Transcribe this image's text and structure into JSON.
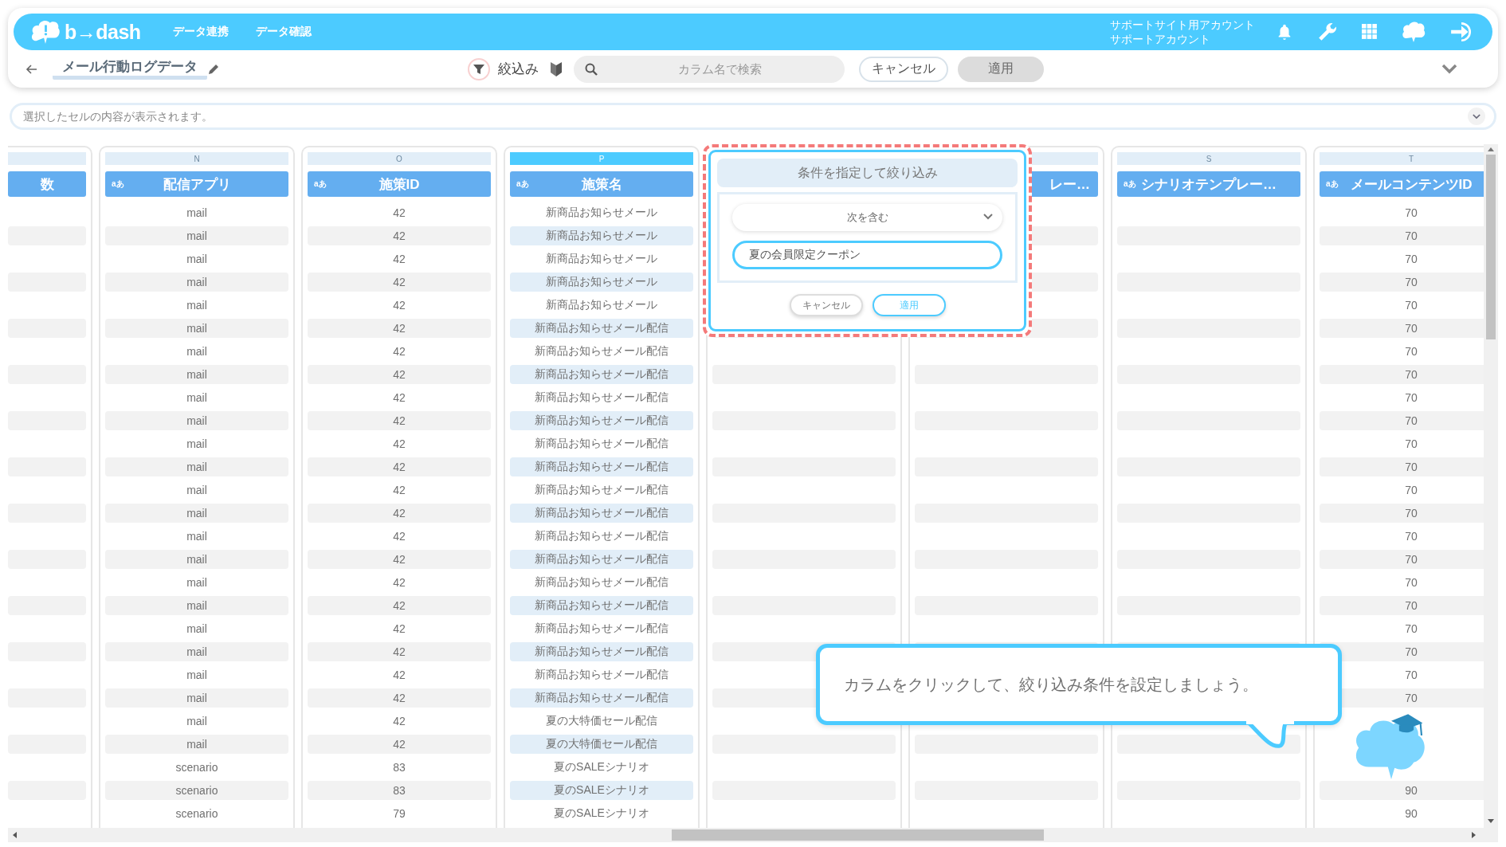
{
  "top_bar": {
    "logo": "b→dash",
    "nav": [
      "データ連携",
      "データ確認"
    ],
    "account": [
      "サポートサイト用アカウント",
      "サポートアカウント"
    ]
  },
  "toolbar": {
    "title": "メール行動ログデータ",
    "filter_label": "絞込み",
    "search": {
      "placeholder": "カラム名で検索"
    },
    "buttons": [
      {
        "label": "キャンセル",
        "disabled": false
      },
      {
        "label": "適用",
        "disabled": true
      }
    ]
  },
  "cell_bar": {
    "placeholder": "選択したセルの内容が表示されます。"
  },
  "table": {
    "columns": [
      {
        "header": "数",
        "selected": false
      },
      {
        "letter": "N",
        "badge": "aあ",
        "header": "配信アプリ",
        "selected": false,
        "cells": [
          "mail",
          "mail",
          "mail",
          "mail",
          "mail",
          "mail",
          "mail",
          "mail",
          "mail",
          "mail",
          "mail",
          "mail",
          "mail",
          "mail",
          "mail",
          "mail",
          "mail",
          "mail",
          "mail",
          "mail",
          "mail",
          "mail",
          "mail",
          "mail",
          "scenario",
          "scenario",
          "scenario"
        ]
      },
      {
        "letter": "O",
        "badge": "aあ",
        "header": "施策ID",
        "selected": false,
        "cells": [
          "42",
          "42",
          "42",
          "42",
          "42",
          "42",
          "42",
          "42",
          "42",
          "42",
          "42",
          "42",
          "42",
          "42",
          "42",
          "42",
          "42",
          "42",
          "42",
          "42",
          "42",
          "42",
          "42",
          "42",
          "83",
          "83",
          "79"
        ]
      },
      {
        "letter": "P",
        "badge": "aあ",
        "header": "施策名",
        "selected": true,
        "cells": [
          "新商品お知らせメール",
          "新商品お知らせメール",
          "新商品お知らせメール",
          "新商品お知らせメール",
          "新商品お知らせメール",
          "新商品お知らせメール配信",
          "新商品お知らせメール配信",
          "新商品お知らせメール配信",
          "新商品お知らせメール配信",
          "新商品お知らせメール配信",
          "新商品お知らせメール配信",
          "新商品お知らせメール配信",
          "新商品お知らせメール配信",
          "新商品お知らせメール配信",
          "新商品お知らせメール配信",
          "新商品お知らせメール配信",
          "新商品お知らせメール配信",
          "新商品お知らせメール配信",
          "新商品お知らせメール配信",
          "新商品お知らせメール配信",
          "新商品お知らせメール配信",
          "新商品お知らせメール配信",
          "夏の大特価セール配信",
          "夏の大特価セール配信",
          "夏のSALEシナリオ",
          "夏のSALEシナリオ",
          "夏のSALEシナリオ"
        ]
      },
      {},
      {
        "header": "レー…",
        "selected": false
      },
      {
        "letter": "S",
        "badge": "aあ",
        "header": "シナリオテンプレー…",
        "selected": false
      },
      {
        "letter": "T",
        "badge": "aあ",
        "header": "メールコンテンツID",
        "selected": false,
        "cells": [
          "70",
          "70",
          "70",
          "70",
          "70",
          "70",
          "70",
          "70",
          "70",
          "70",
          "70",
          "70",
          "70",
          "70",
          "70",
          "70",
          "70",
          "70",
          "70",
          "70",
          "70",
          "70",
          null,
          null,
          null,
          "90",
          "90"
        ]
      }
    ]
  },
  "filter_popup": {
    "title": "条件を指定して絞り込み",
    "operator": "次を含む",
    "value": "夏の会員限定クーポン",
    "buttons": [
      "キャンセル",
      "適用"
    ]
  },
  "hint_bubble": {
    "text": "カラムをクリックして、絞り込み条件を設定しましょう。"
  }
}
